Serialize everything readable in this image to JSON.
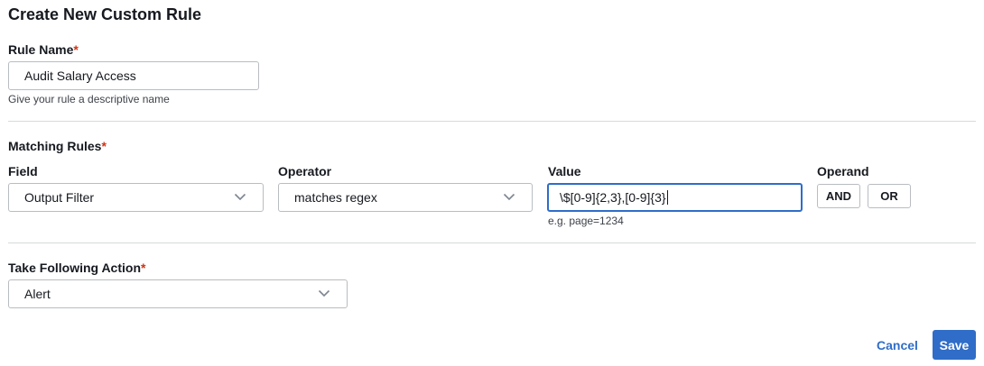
{
  "dialog": {
    "title": "Create New Custom Rule"
  },
  "rule_name": {
    "label": "Rule Name",
    "required_mark": "*",
    "value": "Audit Salary Access",
    "hint": "Give your rule a descriptive name"
  },
  "matching_rules": {
    "label": "Matching Rules",
    "required_mark": "*",
    "field": {
      "label": "Field",
      "selected": "Output Filter"
    },
    "operator": {
      "label": "Operator",
      "selected": "matches regex"
    },
    "value": {
      "label": "Value",
      "value": "\\$[0-9]{2,3},[0-9]{3}",
      "hint": "e.g. page=1234"
    },
    "operand": {
      "label": "Operand",
      "and_label": "AND",
      "or_label": "OR"
    }
  },
  "action": {
    "label": "Take Following Action",
    "required_mark": "*",
    "selected": "Alert"
  },
  "footer": {
    "cancel_label": "Cancel",
    "save_label": "Save"
  },
  "colors": {
    "accent": "#2f6dc8",
    "required": "#d13212",
    "border": "#b8bdc2",
    "divider": "#d5dbdb"
  },
  "icons": {
    "dropdown": "chevron-down-icon"
  }
}
